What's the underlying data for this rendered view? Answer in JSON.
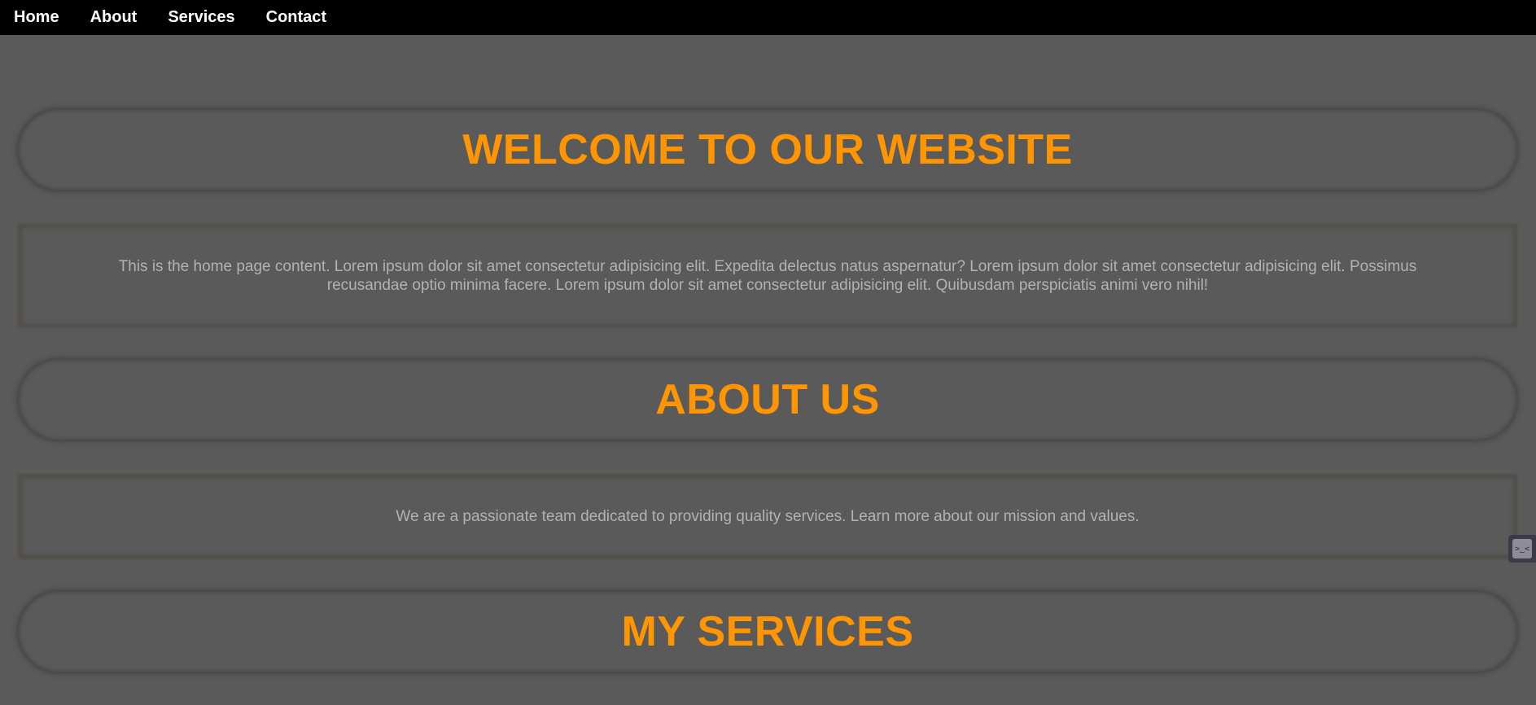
{
  "nav": {
    "items": [
      {
        "label": "Home"
      },
      {
        "label": "About"
      },
      {
        "label": "Services"
      },
      {
        "label": "Contact"
      }
    ]
  },
  "sections": {
    "welcome_title": "WELCOME TO OUR WEBSITE",
    "welcome_text": "This is the home page content. Lorem ipsum dolor sit amet consectetur adipisicing elit. Expedita delectus natus aspernatur? Lorem ipsum dolor sit amet consectetur adipisicing elit. Possimus recusandae optio minima facere. Lorem ipsum dolor sit amet consectetur adipisicing elit. Quibusdam perspiciatis animi vero nihil!",
    "about_title": "ABOUT US",
    "about_text": "We are a passionate team dedicated to providing quality services. Learn more about our mission and values.",
    "services_title": "MY SERVICES"
  },
  "widget": {
    "icon": "extension-icon",
    "glyph": ">‿<"
  },
  "colors": {
    "accent": "#ff9500",
    "background": "#5a5a5a",
    "navbar": "#000000",
    "body_text": "#b2b2b2"
  }
}
